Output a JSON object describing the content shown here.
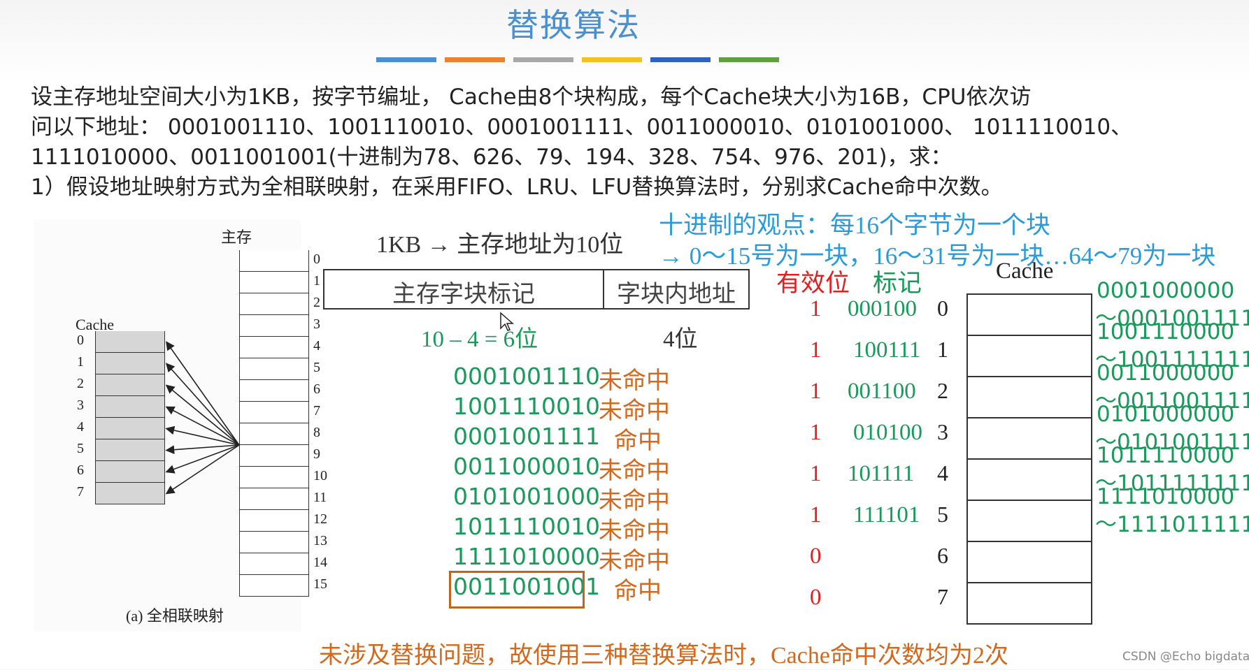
{
  "title": "替换算法",
  "title_bars": [
    "#4a90d0",
    "#f07f30",
    "#a8a8a8",
    "#f5c020",
    "#3060c0",
    "#60a040"
  ],
  "problem": {
    "line1": "设主存地址空间大小为1KB，按字节编址， Cache由8个块构成，每个Cache块大小为16B，CPU依次访",
    "line2": "问以下地址： 0001001110、1001110010、0001001111、0011000010、0101001000、 1011110010、",
    "line3": "1111010000、0011001001(十进制为78、626、79、194、328、754、976、201)，求：",
    "line4": "1）假设地址映射方式为全相联映射，在采用FIFO、LRU、LFU替换算法时，分别求Cache命中次数。"
  },
  "figure": {
    "main_memory_label": "主存",
    "cache_label": "Cache",
    "caption": "(a) 全相联映射",
    "main_blocks": [
      "0",
      "1",
      "2",
      "3",
      "4",
      "5",
      "6",
      "7",
      "8",
      "9",
      "10",
      "11",
      "12",
      "13",
      "14",
      "15"
    ],
    "cache_blocks": [
      "0",
      "1",
      "2",
      "3",
      "4",
      "5",
      "6",
      "7"
    ]
  },
  "address": {
    "size_note": "1KB",
    "arrow": "→",
    "size_result": "主存地址为10位",
    "field_tag": "主存字块标记",
    "field_offset": "字块内地址",
    "tag_bits": "10 – 4 = 6位",
    "offset_bits": "4位"
  },
  "decimal_note": {
    "line1": "十进制的观点：每16个字节为一个块",
    "line2": "→ 0～15号为一块，16～31号为一块…64～79为一块"
  },
  "sequence": [
    {
      "addr": "0001001110",
      "result": "未命中"
    },
    {
      "addr": "1001110010",
      "result": "未命中"
    },
    {
      "addr": "0001001111",
      "result": "命中"
    },
    {
      "addr": "0011000010",
      "result": "未命中"
    },
    {
      "addr": "0101001000",
      "result": "未命中"
    },
    {
      "addr": "1011110010",
      "result": "未命中"
    },
    {
      "addr": "1111010000",
      "result": "未命中"
    },
    {
      "addr": "0011001001",
      "result": "命中"
    }
  ],
  "cache_table": {
    "valid_header": "有效位",
    "tag_header": "标记",
    "cache_title": "Cache",
    "rows": [
      {
        "valid": "1",
        "tag": "000100",
        "index": "0",
        "range_start": "0001000000",
        "range_end": "～0001001111"
      },
      {
        "valid": "1",
        "tag": "100111",
        "index": "1",
        "range_start": "1001110000",
        "range_end": "～1001111111"
      },
      {
        "valid": "1",
        "tag": "001100",
        "index": "2",
        "range_start": "0011000000",
        "range_end": "～0011001111"
      },
      {
        "valid": "1",
        "tag": "010100",
        "index": "3",
        "range_start": "0101000000",
        "range_end": "～0101001111"
      },
      {
        "valid": "1",
        "tag": "101111",
        "index": "4",
        "range_start": "1011110000",
        "range_end": "～1011111111"
      },
      {
        "valid": "1",
        "tag": "111101",
        "index": "5",
        "range_start": "1111010000",
        "range_end": "～1111011111"
      },
      {
        "valid": "0",
        "tag": "",
        "index": "6",
        "range_start": "",
        "range_end": ""
      },
      {
        "valid": "0",
        "tag": "",
        "index": "7",
        "range_start": "",
        "range_end": ""
      }
    ]
  },
  "conclusion": "未涉及替换问题，故使用三种替换算法时，Cache命中次数均为2次",
  "watermark": "CSDN @Echo bigdata"
}
